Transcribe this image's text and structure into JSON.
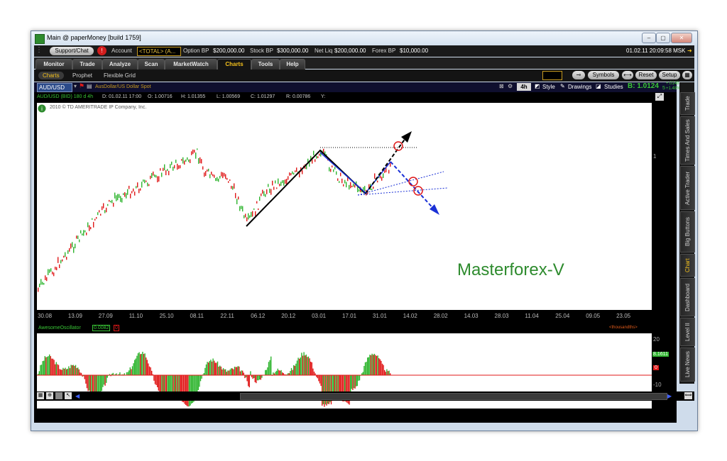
{
  "window": {
    "title": "Main @ paperMoney [build 1759]"
  },
  "account_bar": {
    "support_label": "Support/Chat",
    "alert_count": "!",
    "account_label": "Account",
    "account_value": "<TOTAL> (A...",
    "option_bp_label": "Option BP",
    "option_bp": "$200,000.00",
    "stock_bp_label": "Stock BP",
    "stock_bp": "$300,000.00",
    "net_liq_label": "Net Liq",
    "net_liq": "$200,000.00",
    "forex_bp_label": "Forex BP",
    "forex_bp": "$10,000.00",
    "datetime": "01.02.11 20:09:58 MSK"
  },
  "tabs": [
    "Monitor",
    "Trade",
    "Analyze",
    "Scan",
    "MarketWatch",
    "Charts",
    "Tools",
    "Help"
  ],
  "active_tab": "Charts",
  "subtabs": [
    "Charts",
    "Prophet",
    "Flexible Grid"
  ],
  "toolbar": {
    "symbols": "Symbols",
    "reset": "Reset",
    "setup": "Setup"
  },
  "chart_header": {
    "symbol": "AUD/USD",
    "description": "AusDollar/US Dollar Spot",
    "timeframe": "4h",
    "style": "Style",
    "drawings": "Drawings",
    "studies": "Studies",
    "bid": "B: 1.0124",
    "bid_suffix": "5",
    "change": "+.0148",
    "change_pct": "+1.48%"
  },
  "ohlc": {
    "name": "AUD/USD (BID) 180 d 4h",
    "date": "D: 01.02.11 17:00",
    "open": "O: 1.00716",
    "high": "H: 1.01355",
    "low": "L: 1.00569",
    "close": "C: 1.01297",
    "range": "R: 0.00786",
    "y": "Y:"
  },
  "copyright": "2010 © TD AMERITRADE IP Company, Inc.",
  "watermark": "Masterforex-V",
  "price_axis_label": "1",
  "dates": [
    "30.08",
    "13.09",
    "27.09",
    "11.10",
    "25.10",
    "08.11",
    "22.11",
    "06.12",
    "20.12",
    "03.01",
    "17.01",
    "31.01",
    "14.02",
    "28.02",
    "14.03",
    "28.03",
    "11.04",
    "25.04",
    "09.05",
    "23.05"
  ],
  "oscillator": {
    "name": "AwesomeOscillator",
    "value": "0.0082",
    "zero": "0",
    "units": "<thousandths>",
    "axis_top": "20",
    "axis_bottom": "-10",
    "current_value": "8.1611",
    "zero_badge": "0"
  },
  "side_tabs": [
    "Trade",
    "Times And Sales",
    "Active Trader",
    "Big Buttons",
    "Chart",
    "Dashboard",
    "Level II",
    "Live News"
  ],
  "colors": {
    "up": "#2fb52f",
    "down": "#e01919",
    "accent": "#f3c01c",
    "watermark": "#2e8b2e"
  }
}
